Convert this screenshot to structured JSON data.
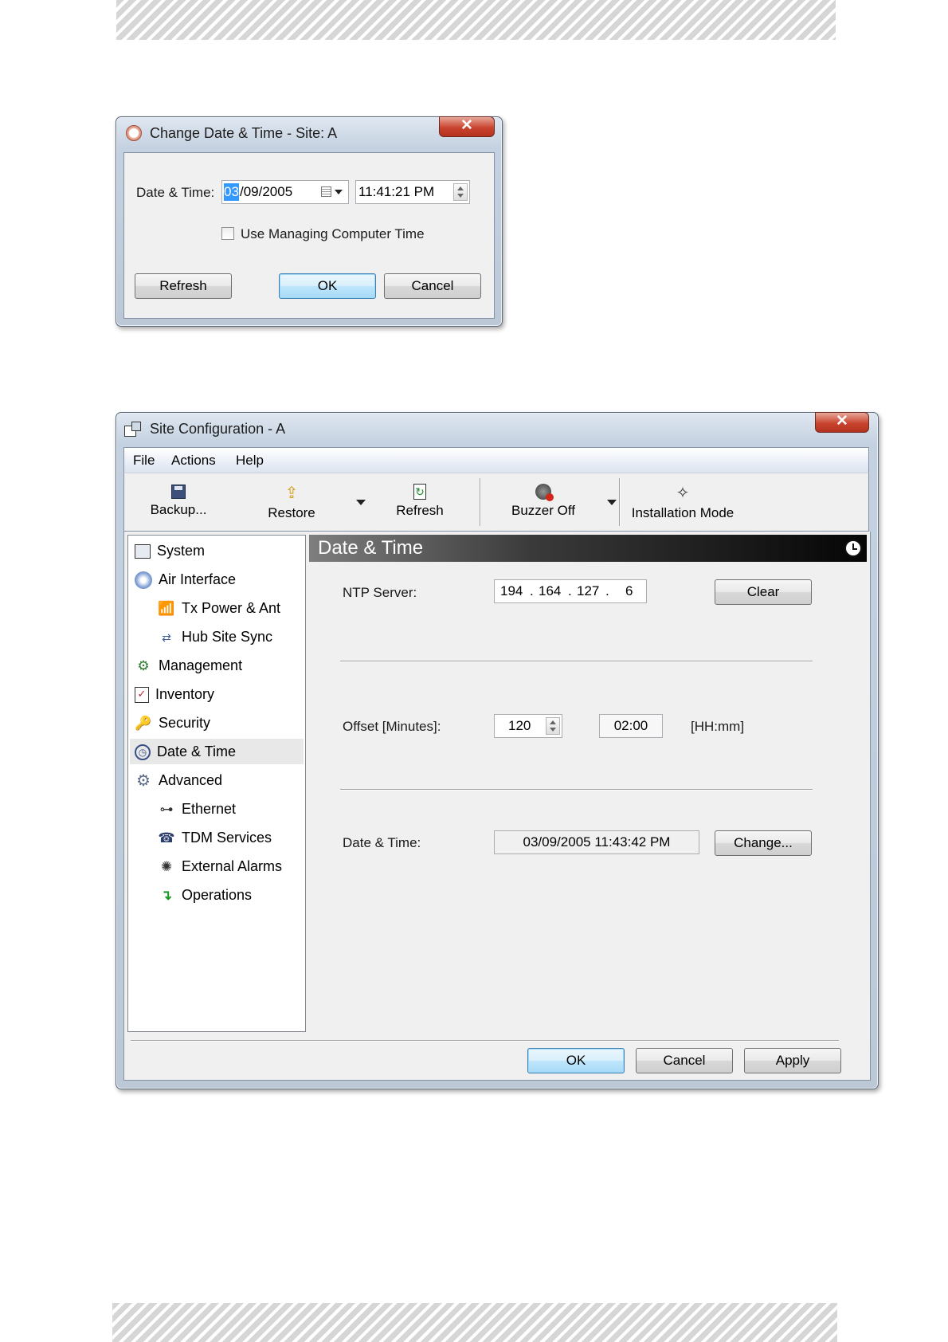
{
  "dialog": {
    "title": "Change Date & Time - Site: A",
    "close_label": "✕",
    "date_time_label": "Date & Time:",
    "date_selected_part": "03",
    "date_rest": "/09/2005",
    "time_value": "11:41:21 PM",
    "use_managing_label": "Use Managing Computer Time",
    "use_managing_checked": false,
    "refresh_label": "Refresh",
    "ok_label": "OK",
    "cancel_label": "Cancel"
  },
  "site": {
    "title": "Site Configuration - A",
    "close_label": "✕",
    "menu": [
      "File",
      "Actions",
      "Help"
    ],
    "toolbar": {
      "backup_label": "Backup...",
      "restore_label": "Restore",
      "refresh_label": "Refresh",
      "buzzer_label": "Buzzer Off",
      "installation_label": "Installation Mode"
    },
    "tree": [
      {
        "label": "System",
        "icon": "system-icon",
        "selected": false
      },
      {
        "label": "Air Interface",
        "icon": "air-interface-icon",
        "selected": false
      },
      {
        "label": "Tx Power & Ant",
        "icon": "antenna-icon",
        "selected": false
      },
      {
        "label": "Hub Site Sync",
        "icon": "sync-icon",
        "selected": false
      },
      {
        "label": "Management",
        "icon": "management-icon",
        "selected": false
      },
      {
        "label": "Inventory",
        "icon": "inventory-icon",
        "selected": false
      },
      {
        "label": "Security",
        "icon": "security-icon",
        "selected": false
      },
      {
        "label": "Date & Time",
        "icon": "clock-icon",
        "selected": true
      },
      {
        "label": "Advanced",
        "icon": "advanced-icon",
        "selected": false
      },
      {
        "label": "Ethernet",
        "icon": "ethernet-icon",
        "selected": false
      },
      {
        "label": "TDM Services",
        "icon": "tdm-icon",
        "selected": false
      },
      {
        "label": "External Alarms",
        "icon": "alarm-icon",
        "selected": false
      },
      {
        "label": "Operations",
        "icon": "operations-icon",
        "selected": false
      }
    ],
    "panel": {
      "header": "Date & Time",
      "ntp_label": "NTP Server:",
      "ntp_octets": [
        "194",
        "164",
        "127",
        "6"
      ],
      "clear_label": "Clear",
      "offset_label": "Offset [Minutes]:",
      "offset_value": "120",
      "offset_hhmm": "02:00",
      "hhmm_label": "[HH:mm]",
      "date_time_label": "Date & Time:",
      "date_time_value": "03/09/2005 11:43:42 PM",
      "change_label": "Change..."
    },
    "buttons": {
      "ok": "OK",
      "cancel": "Cancel",
      "apply": "Apply"
    }
  },
  "colors": {
    "selection_blue": "#3399ff",
    "header_dark": "#111111",
    "tree_selected_bg": "#e8e8e8"
  }
}
